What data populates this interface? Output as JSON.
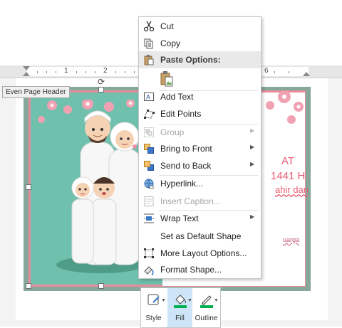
{
  "ruler": {
    "numbers": [
      "1",
      "2",
      "6"
    ]
  },
  "header_tag": "Even Page Header",
  "card_texts": {
    "line1": "AT",
    "line2": "1441 H",
    "line3": "ahir dan",
    "small": "uarga"
  },
  "menu": {
    "items": [
      {
        "label": "Cut",
        "icon": "scissors-icon",
        "disabled": false,
        "submenu": false
      },
      {
        "label": "Copy",
        "icon": "copy-icon",
        "disabled": false,
        "submenu": false
      },
      {
        "label": "Paste Options:",
        "icon": "clipboard-icon",
        "header": true
      },
      {
        "label": "",
        "icon": "paste-picture-icon"
      },
      {
        "label": "Add Text",
        "icon": "textbox-icon",
        "disabled": false,
        "submenu": false
      },
      {
        "label": "Edit Points",
        "icon": "edit-points-icon",
        "disabled": false,
        "submenu": false
      },
      {
        "label": "Group",
        "icon": "group-icon",
        "disabled": true,
        "submenu": true
      },
      {
        "label": "Bring to Front",
        "icon": "bring-front-icon",
        "disabled": false,
        "submenu": true
      },
      {
        "label": "Send to Back",
        "icon": "send-back-icon",
        "disabled": false,
        "submenu": true
      },
      {
        "label": "Hyperlink...",
        "icon": "hyperlink-icon",
        "disabled": false,
        "submenu": false
      },
      {
        "label": "Insert Caption...",
        "icon": "caption-icon",
        "disabled": true,
        "submenu": false
      },
      {
        "label": "Wrap Text",
        "icon": "wrap-text-icon",
        "disabled": false,
        "submenu": true
      },
      {
        "label": "Set as Default Shape",
        "icon": "",
        "disabled": false,
        "submenu": false
      },
      {
        "label": "More Layout Options...",
        "icon": "layout-options-icon",
        "disabled": false,
        "submenu": false
      },
      {
        "label": "Format Shape...",
        "icon": "format-shape-icon",
        "disabled": false,
        "submenu": false
      }
    ]
  },
  "mini_toolbar": {
    "style_label": "Style",
    "fill_label": "Fill",
    "outline_label": "Outline",
    "fill_color": "#00b050",
    "outline_color": "#00b050"
  }
}
